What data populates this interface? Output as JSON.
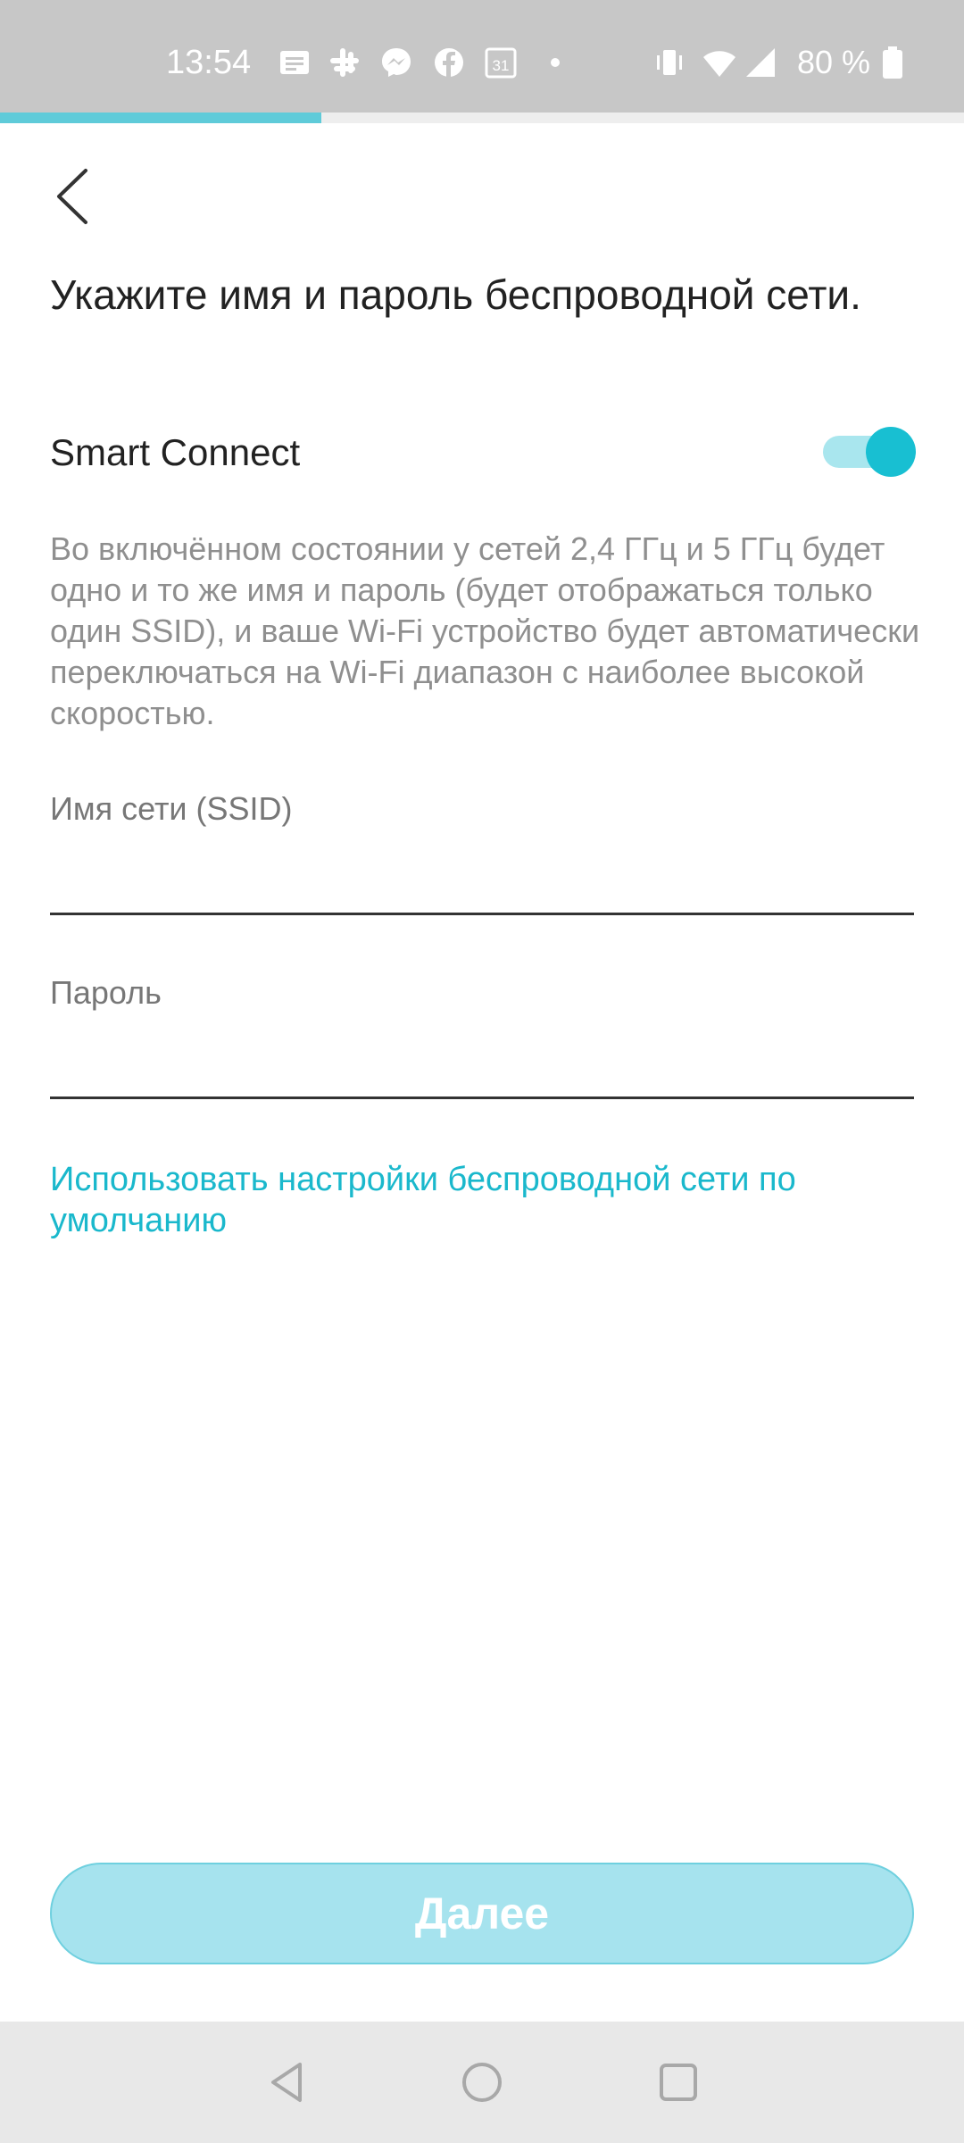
{
  "status_bar": {
    "time": "13:54",
    "battery_text": "80 %",
    "calendar_day": "31",
    "icons": [
      "message-icon",
      "slack-icon",
      "messenger-icon",
      "facebook-icon",
      "calendar-icon",
      "dot-icon",
      "vibrate-icon",
      "wifi-icon",
      "signal-icon",
      "battery-icon"
    ]
  },
  "progress": {
    "fraction": 0.333
  },
  "header": {
    "back_icon": "chevron-left-icon"
  },
  "title": "Укажите имя и пароль беспроводной сети.",
  "smart_connect": {
    "label": "Smart Connect",
    "enabled": true,
    "description": "Во включённом состоянии у сетей 2,4 ГГц и 5 ГГц будет одно и то же имя и пароль (будет отображаться только один SSID), и ваше Wi-Fi устройство будет автоматически переключаться на Wi-Fi диапазон с наиболее высокой скоростью."
  },
  "fields": {
    "ssid_label": "Имя сети (SSID)",
    "ssid_value": "",
    "password_label": "Пароль",
    "password_value": ""
  },
  "default_link": "Использовать настройки беспроводной сети по умолчанию",
  "next_button": "Далее",
  "colors": {
    "accent": "#18bfd2",
    "button_disabled": "#a6e3ee",
    "link": "#1ab8cc"
  },
  "nav_bar": {
    "icons": [
      "nav-back-icon",
      "nav-home-icon",
      "nav-recents-icon"
    ]
  }
}
